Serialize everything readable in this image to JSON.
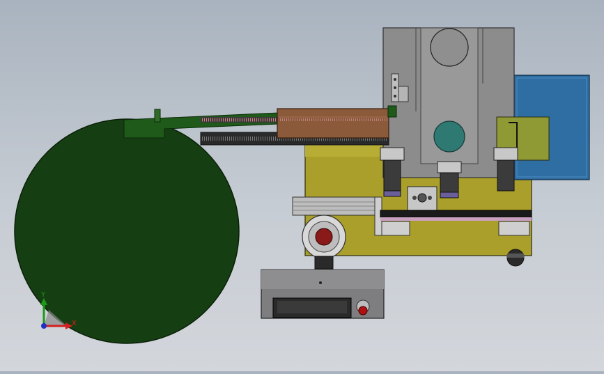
{
  "viewport": {
    "background_top": "#a9b3bf",
    "background_bottom": "#d3d6db"
  },
  "triad": {
    "x_label": "X",
    "y_label": "Y",
    "x_color": "#d42020",
    "y_color": "#1a9a1a",
    "z_color": "#2030c0"
  },
  "colors": {
    "reel_green": "#153f12",
    "base_olive": "#aa9f2a",
    "motor_panel_blue": "#2e6ea3",
    "housing_gray": "#8c8c8c",
    "feeder_brown": "#8a5a3a",
    "control_box_gray": "#7e7e80"
  }
}
